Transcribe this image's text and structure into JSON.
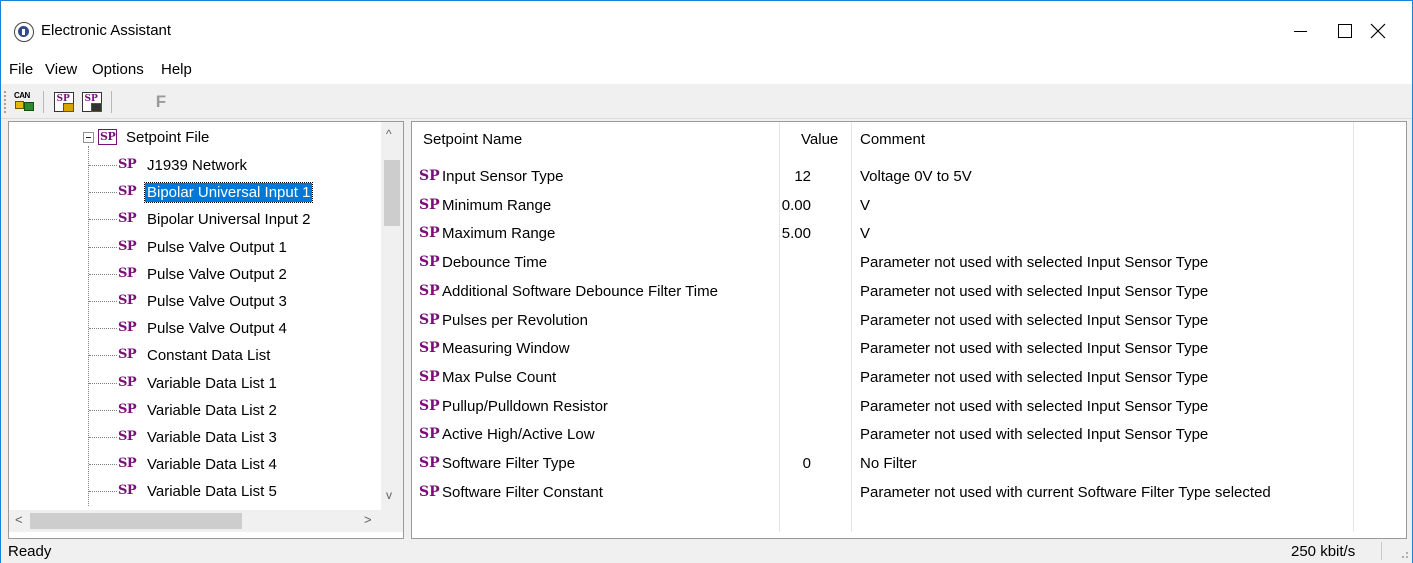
{
  "window": {
    "title": "Electronic Assistant"
  },
  "menu": [
    "File",
    "View",
    "Options",
    "Help"
  ],
  "toolbar": {
    "can_label": "CAN",
    "sp_open_letters": "SP",
    "sp_save_letters": "SP",
    "f_label": "F"
  },
  "tree": {
    "root_label": "Setpoint File",
    "items": [
      "J1939 Network",
      "Bipolar Universal Input 1",
      "Bipolar Universal Input 2",
      "Pulse Valve Output 1",
      "Pulse Valve Output 2",
      "Pulse Valve Output 3",
      "Pulse Valve Output 4",
      "Constant Data List",
      "Variable Data List 1",
      "Variable Data List 2",
      "Variable Data List 3",
      "Variable Data List 4",
      "Variable Data List 5"
    ],
    "selected_index": 1,
    "icon_letters": "SP",
    "scroll_up": "^",
    "scroll_down": "v",
    "scroll_left": "<",
    "scroll_right": ">"
  },
  "table": {
    "headers": {
      "name": "Setpoint Name",
      "value": "Value",
      "comment": "Comment"
    },
    "row_tag": "SP",
    "rows": [
      {
        "name": "Input Sensor Type",
        "value": "12",
        "comment": "Voltage 0V to 5V"
      },
      {
        "name": "Minimum Range",
        "value": "0.00",
        "comment": "V"
      },
      {
        "name": "Maximum Range",
        "value": "5.00",
        "comment": "V"
      },
      {
        "name": "Debounce Time",
        "value": "",
        "comment": "Parameter not used with selected Input Sensor Type"
      },
      {
        "name": "Additional Software Debounce Filter Time",
        "value": "",
        "comment": "Parameter not used with selected Input Sensor Type"
      },
      {
        "name": "Pulses per Revolution",
        "value": "",
        "comment": "Parameter not used with selected Input Sensor Type"
      },
      {
        "name": "Measuring Window",
        "value": "",
        "comment": "Parameter not used with selected Input Sensor Type"
      },
      {
        "name": "Max Pulse Count",
        "value": "",
        "comment": "Parameter not used with selected Input Sensor Type"
      },
      {
        "name": "Pullup/Pulldown Resistor",
        "value": "",
        "comment": "Parameter not used with selected Input Sensor Type"
      },
      {
        "name": "Active High/Active Low",
        "value": "",
        "comment": "Parameter not used with selected Input Sensor Type"
      },
      {
        "name": "Software Filter Type",
        "value": "0",
        "comment": "No Filter"
      },
      {
        "name": "Software Filter Constant",
        "value": "",
        "comment": "Parameter not used with current Software Filter Type selected"
      }
    ]
  },
  "status": {
    "text": "Ready",
    "speed": "250 kbit/s"
  },
  "colors": {
    "accent": "#0078d7",
    "sp_purple": "#7a0f7a",
    "window_border": "#1883d7"
  }
}
